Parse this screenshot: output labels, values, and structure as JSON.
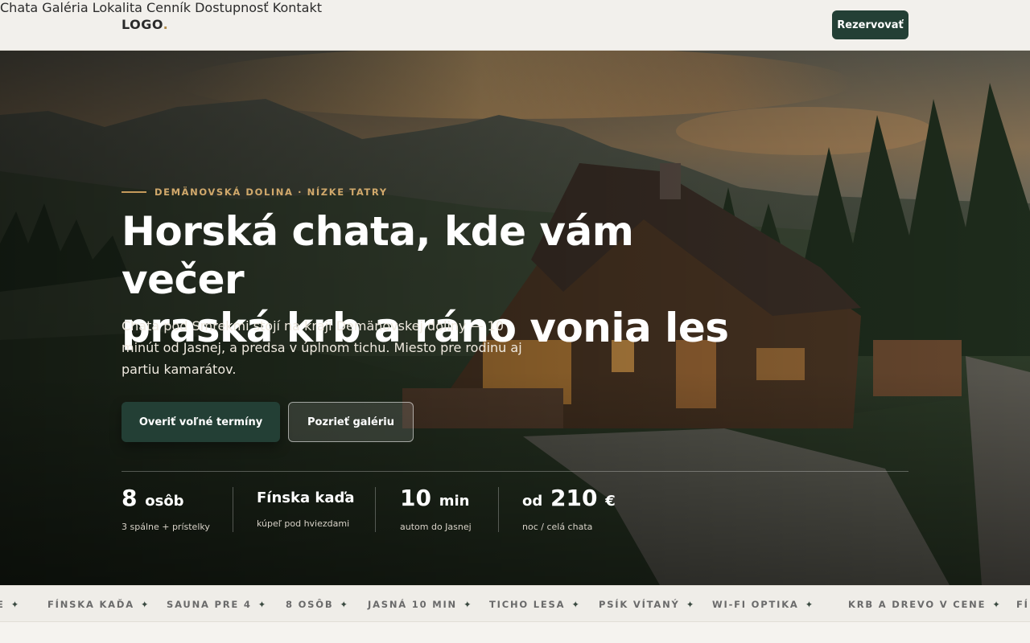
{
  "nav": {
    "logo": "LOGO",
    "logo_dot": ".",
    "items": [
      "Chata",
      "Galéria",
      "Lokalita",
      "Cenník",
      "Dostupnosť",
      "Kontakt"
    ],
    "cta": "Rezervovať"
  },
  "hero": {
    "eyebrow": "DEMÄNOVSKÁ DOLINA · NÍZKE TATRY",
    "headline_line1": "Horská chata, kde vám večer",
    "headline_line2": "praská krb a ráno vonia les",
    "subtext": "Chata pod Smrekmi stojí na kraji Demänovskej doliny — 10 minút od Jasnej, a predsa v úplnom tichu. Miesto pre rodinu aj partiu kamarátov.",
    "primary_button": "Overiť voľné termíny",
    "secondary_button": "Pozrieť galériu"
  },
  "stats": [
    {
      "value": "8",
      "unit": "osôb",
      "label": "3 spálne + prístelky"
    },
    {
      "value": "Fínska kaďa",
      "label": "kúpeľ pod hviezdami"
    },
    {
      "value": "10",
      "unit": "min",
      "label": "autom do Jasnej"
    },
    {
      "prefix": "od",
      "value": "210",
      "unit": "€",
      "label": "noc / celá chata"
    }
  ],
  "ticker": [
    "E",
    "FÍNSKA KAĎA",
    "SAUNA PRE 4",
    "8 OSÔB",
    "JASNÁ 10 MIN",
    "TICHO LESA",
    "PSÍK VÍTANÝ",
    "WI-FI OPTIKA",
    "KRB A DREVO V CENE",
    "FÍ"
  ],
  "icons": {
    "ticker_separator": "sparkle-icon"
  },
  "colors": {
    "accent_green": "#233f35",
    "accent_gold": "#c59a5b"
  }
}
